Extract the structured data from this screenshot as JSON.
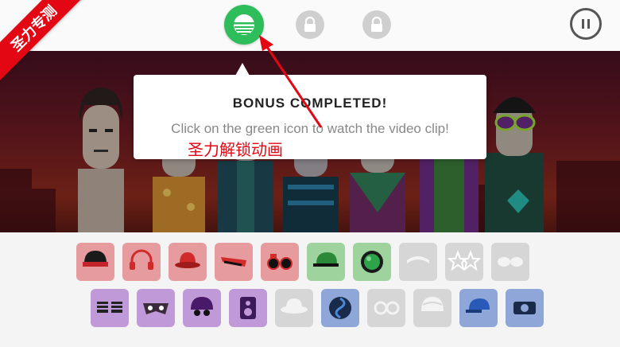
{
  "watermark": {
    "label": "圣力专测"
  },
  "top_buttons": {
    "bonus_icon": "bonus-video-icon",
    "lock_icon": "lock-icon",
    "pause_icon": "pause-icon"
  },
  "tooltip": {
    "title": "BONUS COMPLETED!",
    "message": "Click on the green icon to watch the video clip!"
  },
  "overlay_annotation": "圣力解锁动画",
  "colors": {
    "bonus_green": "#2dbd5a",
    "ribbon_red": "#e30613",
    "item_red": "#e69c9e",
    "item_green": "#9ed39e",
    "item_grey": "#d6d6d6",
    "item_purple": "#c09ad8",
    "item_blue": "#8ea6d8"
  },
  "sound_icons_row1": [
    {
      "name": "beanie-hat-icon",
      "color": "red"
    },
    {
      "name": "headphones-icon",
      "color": "red"
    },
    {
      "name": "bowler-hat-icon",
      "color": "red"
    },
    {
      "name": "visor-glasses-icon",
      "color": "red"
    },
    {
      "name": "round-glasses-icon",
      "color": "red"
    },
    {
      "name": "cap-icon",
      "color": "green"
    },
    {
      "name": "ball-icon",
      "color": "green"
    },
    {
      "name": "headband-icon",
      "color": "grey"
    },
    {
      "name": "star-glasses-icon",
      "color": "grey"
    },
    {
      "name": "goggles-icon",
      "color": "grey"
    }
  ],
  "sound_icons_row2": [
    {
      "name": "shutter-shades-icon",
      "color": "purple"
    },
    {
      "name": "mask-icon",
      "color": "purple"
    },
    {
      "name": "helmet-icon",
      "color": "purple"
    },
    {
      "name": "speaker-icon",
      "color": "purple"
    },
    {
      "name": "fedora-icon",
      "color": "grey"
    },
    {
      "name": "swirl-icon",
      "color": "blue"
    },
    {
      "name": "monocle-icon",
      "color": "grey"
    },
    {
      "name": "turban-icon",
      "color": "grey"
    },
    {
      "name": "baseball-cap-icon",
      "color": "blue"
    },
    {
      "name": "camera-icon",
      "color": "blue"
    }
  ]
}
